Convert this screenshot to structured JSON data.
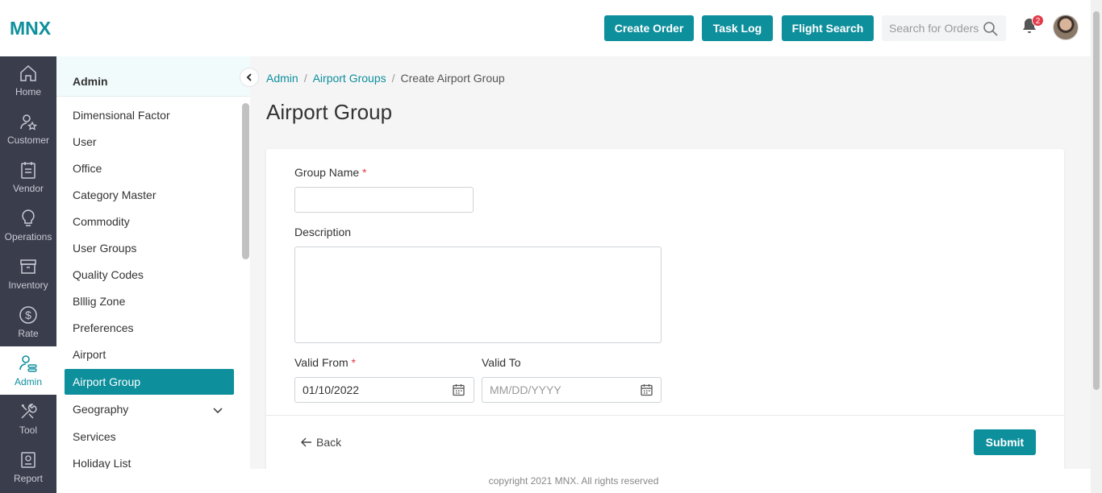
{
  "header": {
    "logo": "MNX",
    "buttons": [
      "Create Order",
      "Task Log",
      "Flight Search"
    ],
    "search_placeholder": "Search for Orders",
    "notification_count": "2"
  },
  "leftnav": [
    {
      "label": "Home",
      "icon": "home-icon"
    },
    {
      "label": "Customer",
      "icon": "customer-icon"
    },
    {
      "label": "Vendor",
      "icon": "vendor-icon"
    },
    {
      "label": "Operations",
      "icon": "lightbulb-icon"
    },
    {
      "label": "Inventory",
      "icon": "inventory-icon"
    },
    {
      "label": "Rate",
      "icon": "dollar-icon"
    },
    {
      "label": "Admin",
      "icon": "admin-icon",
      "active": true
    },
    {
      "label": "Tool",
      "icon": "tool-icon"
    },
    {
      "label": "Report",
      "icon": "report-icon"
    }
  ],
  "submenu": {
    "title": "Admin",
    "items": [
      "Dimensional Factor",
      "User",
      "Office",
      "Category Master",
      "Commodity",
      "User Groups",
      "Quality Codes",
      "Blllig Zone",
      "Preferences",
      "Airport",
      "Airport Group",
      "Geography",
      "Services",
      "Holiday List"
    ],
    "active": "Airport Group"
  },
  "breadcrumb": [
    "Admin",
    "Airport Groups",
    "Create Airport Group"
  ],
  "page_title": "Airport Group",
  "form": {
    "group_name_label": "Group Name",
    "group_name_value": "",
    "description_label": "Description",
    "description_value": "",
    "valid_from_label": "Valid From",
    "valid_from_value": "01/10/2022",
    "valid_to_label": "Valid To",
    "valid_to_placeholder": "MM/DD/YYYY",
    "required_mark": "*"
  },
  "actions": {
    "back": "Back",
    "submit": "Submit"
  },
  "footer": "copyright 2021 MNX. All rights reserved",
  "colors": {
    "accent": "#0e8f9c",
    "nav": "#3a3d4c",
    "badge": "#e23b4a"
  }
}
